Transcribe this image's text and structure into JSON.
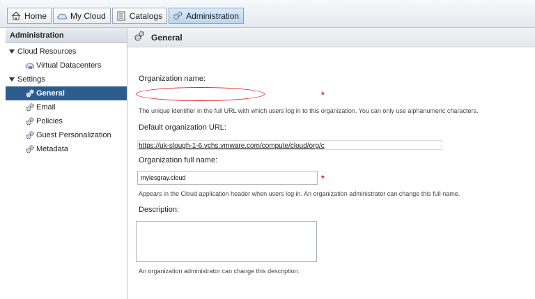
{
  "tabs": [
    {
      "label": "Home",
      "icon": "home-icon"
    },
    {
      "label": "My Cloud",
      "icon": "cloud-icon"
    },
    {
      "label": "Catalogs",
      "icon": "catalog-icon"
    },
    {
      "label": "Administration",
      "icon": "admin-icon",
      "active": true
    }
  ],
  "sidebar": {
    "header": "Administration",
    "items": [
      {
        "label": "Cloud Resources"
      },
      {
        "label": "Virtual Datacenters"
      },
      {
        "label": "Settings"
      },
      {
        "label": "General",
        "selected": true
      },
      {
        "label": "Email"
      },
      {
        "label": "Policies"
      },
      {
        "label": "Guest Personalization"
      },
      {
        "label": "Metadata"
      }
    ]
  },
  "main": {
    "title": "General",
    "org_name_label": "Organization name:",
    "org_name_value": "",
    "org_name_hint": "The unique identifier in the full URL with which users log in to this organization. You can only use alphanumeric characters.",
    "default_url_label": "Default organization URL:",
    "default_url_value": "https://uk-slough-1-6.vchs.vmware.com/compute/cloud/org/c",
    "full_name_label": "Organization full name:",
    "full_name_value": "mylesgray.cloud",
    "full_name_hint": "Appears in the Cloud application header when users log in. An organization administrator can change this full name.",
    "description_label": "Description:",
    "description_value": "",
    "description_hint": "An organization administrator can change this description.",
    "required_mark": "*"
  },
  "colors": {
    "selected_bg": "#2c5b8e",
    "required": "#dd2222",
    "annotation": "#e02020"
  }
}
